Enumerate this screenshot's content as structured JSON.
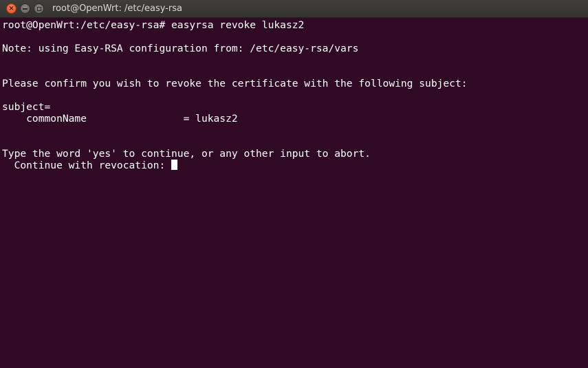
{
  "window": {
    "title": "root@OpenWrt: /etc/easy-rsa",
    "close_glyph": "×",
    "min_glyph": "–",
    "max_glyph": "□"
  },
  "terminal": {
    "background": "#300a24",
    "foreground": "#ffffff",
    "lines": [
      "root@OpenWrt:/etc/easy-rsa# easyrsa revoke lukasz2",
      "",
      "Note: using Easy-RSA configuration from: /etc/easy-rsa/vars",
      "",
      "",
      "Please confirm you wish to revoke the certificate with the following subject:",
      "",
      "subject=",
      "    commonName                = lukasz2",
      "",
      "",
      "Type the word 'yes' to continue, or any other input to abort.",
      "  Continue with revocation: "
    ]
  }
}
